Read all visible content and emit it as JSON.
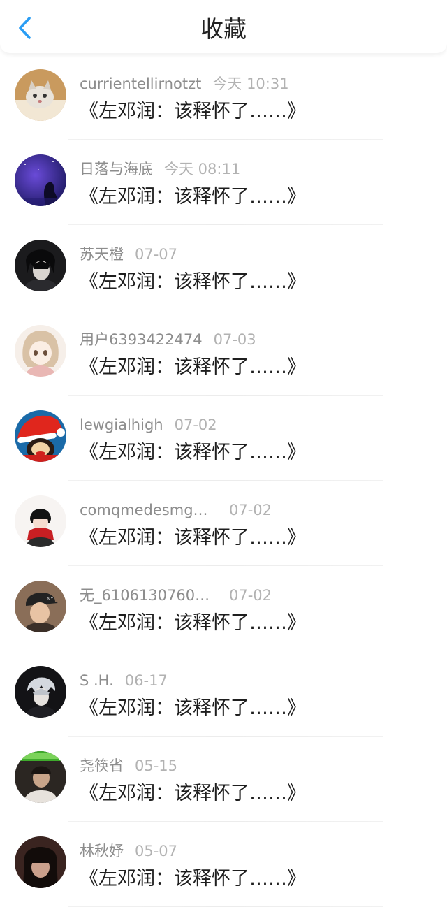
{
  "header": {
    "title": "收藏",
    "back_icon": "chevron-left-icon",
    "accent": "#2a9df4"
  },
  "items": [
    {
      "name": "currientellirnotzt",
      "date": "今天 10:31",
      "title": "《左邓润：该释怀了……》",
      "avatar": "cat-photo"
    },
    {
      "name": "日落与海底",
      "date": "今天 08:11",
      "title": "《左邓润：该释怀了……》",
      "avatar": "night-sky-silhouette"
    },
    {
      "name": "苏天橙",
      "date": "07-07",
      "title": "《左邓润：该释怀了……》",
      "avatar": "dark-anime-boy"
    },
    {
      "name": "用户6393422474",
      "date": "07-03",
      "title": "《左邓润：该释怀了……》",
      "avatar": "anime-girl-sketch"
    },
    {
      "name": "lewgialhigh",
      "date": "07-02",
      "title": "《左邓润：该释怀了……》",
      "avatar": "monkey-santa-hat"
    },
    {
      "name": "comqmedesmg…",
      "date": "07-02",
      "title": "《左邓润：该释怀了……》",
      "avatar": "anime-red-scarf"
    },
    {
      "name": "无_6106130760…",
      "date": "07-02",
      "title": "《左邓润：该释怀了……》",
      "avatar": "boy-ny-cap"
    },
    {
      "name": "S .H.",
      "date": "06-17",
      "title": "《左邓润：该释怀了……》",
      "avatar": "dark-anime-silver-hair"
    },
    {
      "name": "尧筷省",
      "date": "05-15",
      "title": "《左邓润：该释怀了……》",
      "avatar": "green-banner-photo"
    },
    {
      "name": "林秋妤",
      "date": "05-07",
      "title": "《左邓润：该释怀了……》",
      "avatar": "dark-hair-girl"
    }
  ]
}
